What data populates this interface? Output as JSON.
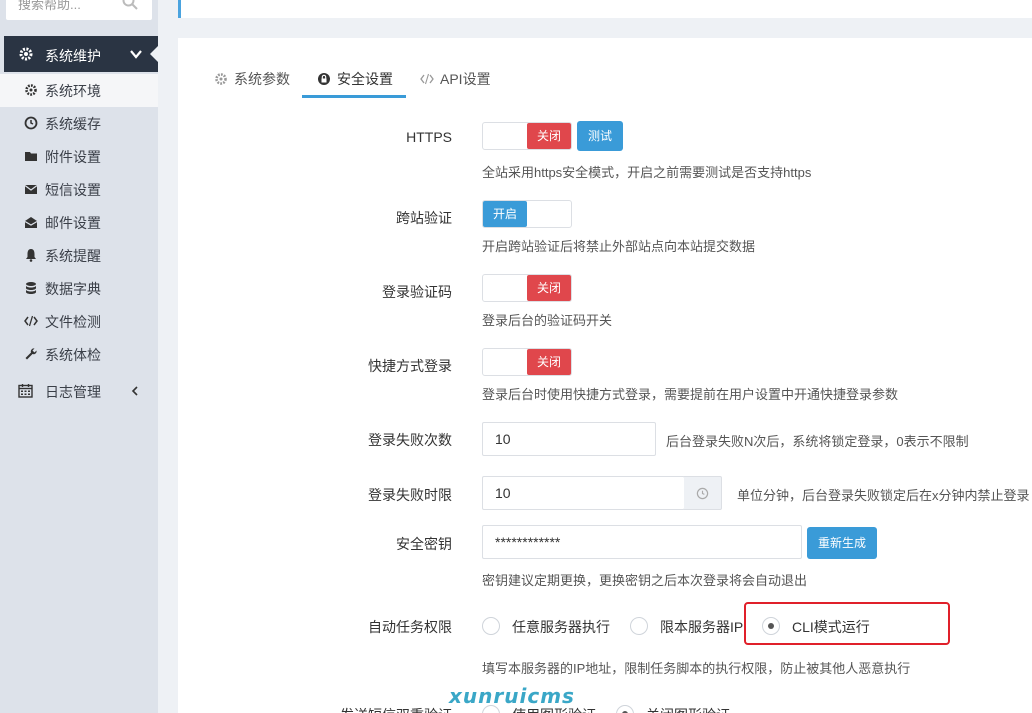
{
  "sidebar": {
    "search_placeholder": "搜索帮助...",
    "group_title": "系统维护",
    "items": [
      {
        "label": "系统环境",
        "icon": "gear-icon"
      },
      {
        "label": "系统缓存",
        "icon": "clock-icon"
      },
      {
        "label": "附件设置",
        "icon": "folder-icon"
      },
      {
        "label": "短信设置",
        "icon": "envelope-icon"
      },
      {
        "label": "邮件设置",
        "icon": "open-envelope-icon"
      },
      {
        "label": "系统提醒",
        "icon": "bell-icon"
      },
      {
        "label": "数据字典",
        "icon": "database-icon"
      },
      {
        "label": "文件检测",
        "icon": "code-icon"
      },
      {
        "label": "系统体检",
        "icon": "wrench-icon"
      }
    ],
    "log_group": "日志管理"
  },
  "tabs": [
    {
      "label": "系统参数",
      "icon": "gear-icon"
    },
    {
      "label": "安全设置",
      "icon": "lock-icon"
    },
    {
      "label": "API设置",
      "icon": "code-icon"
    }
  ],
  "form": {
    "https": {
      "label": "HTTPS",
      "switch": "关闭",
      "test_button": "测试",
      "help": "全站采用https安全模式，开启之前需要测试是否支持https"
    },
    "csrf": {
      "label": "跨站验证",
      "switch": "开启",
      "help": "开启跨站验证后将禁止外部站点向本站提交数据"
    },
    "captcha": {
      "label": "登录验证码",
      "switch": "关闭",
      "help": "登录后台的验证码开关"
    },
    "quick_login": {
      "label": "快捷方式登录",
      "switch": "关闭",
      "help": "登录后台时使用快捷方式登录，需要提前在用户设置中开通快捷登录参数"
    },
    "fail_count": {
      "label": "登录失败次数",
      "value": "10",
      "help": "后台登录失败N次后，系统将锁定登录，0表示不限制"
    },
    "fail_time": {
      "label": "登录失败时限",
      "value": "10",
      "help": "单位分钟，后台登录失败锁定后在x分钟内禁止登录"
    },
    "secret_key": {
      "label": "安全密钥",
      "value": "************",
      "regen_button": "重新生成",
      "help": "密钥建议定期更换，更换密钥之后本次登录将会自动退出"
    },
    "cron": {
      "label": "自动任务权限",
      "options": [
        "任意服务器执行",
        "限本服务器IP",
        "CLI模式运行"
      ],
      "selected": "CLI模式运行",
      "help": "填写本服务器的IP地址，限制任务脚本的执行权限，防止被其他人恶意执行"
    },
    "sms": {
      "label": "发送短信双重验证",
      "options": [
        "使用图形验证",
        "关闭图形验证"
      ]
    }
  },
  "watermark": "xunruicms"
}
